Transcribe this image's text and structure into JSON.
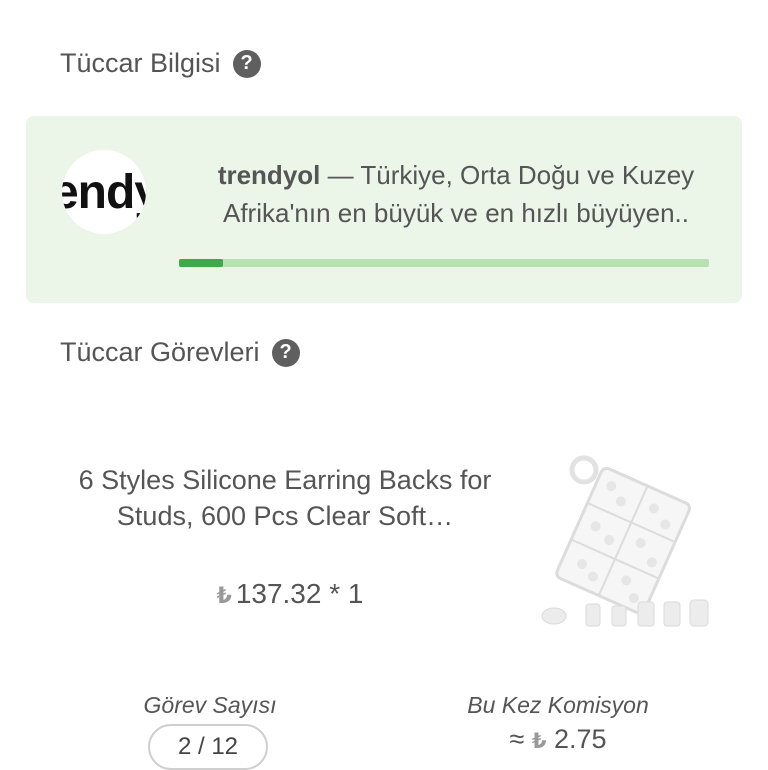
{
  "merchant_info": {
    "title": "Tüccar Bilgisi",
    "help_icon": "question-circle-icon",
    "logo_text": "endy",
    "name": "trendyol",
    "description": " — Türkiye, Orta Doğu ve Kuzey Afrika'nın en büyük ve en hızlı büyüyen..",
    "progress_fraction": 0.083,
    "colors": {
      "card_bg": "#ebf5e8",
      "progress_track": "#b7e1b1",
      "progress_fill": "#3fa847"
    }
  },
  "merchant_tasks": {
    "title": "Tüccar Görevleri",
    "help_icon": "question-circle-icon",
    "product": {
      "title": "6 Styles Silicone Earring Backs for Studs, 600 Pcs Clear Soft…",
      "currency_symbol": "₺",
      "price": "137.32 * 1",
      "image": "earring-backs-box-image"
    },
    "task_count_label": "Görev Sayısı",
    "task_count_value": "2 / 12",
    "commission_label": "Bu Kez Komisyon",
    "commission_prefix": "≈",
    "commission_currency": "₺",
    "commission_value": "2.75"
  }
}
